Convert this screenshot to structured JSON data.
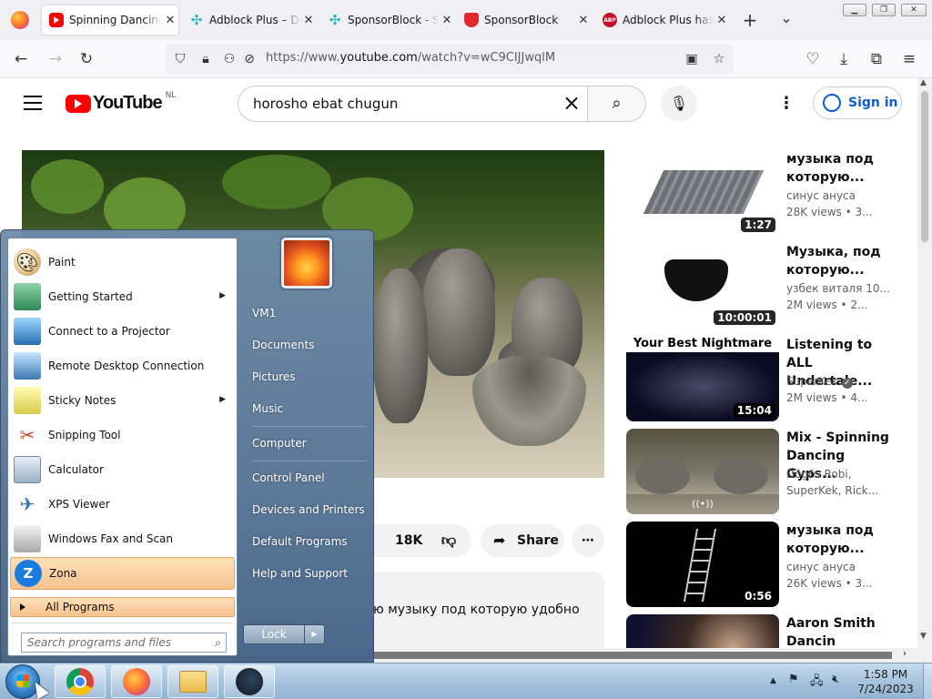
{
  "browser": {
    "tabs": [
      {
        "title": "Spinning Dancing",
        "icon": "youtube-icon",
        "active": true
      },
      {
        "title": "Adblock Plus – De",
        "icon": "sponsorblock-icon",
        "active": false
      },
      {
        "title": "SponsorBlock - Sk",
        "icon": "sponsorblock-icon",
        "active": false
      },
      {
        "title": "SponsorBlock",
        "icon": "shield-icon",
        "active": false
      },
      {
        "title": "Adblock Plus has",
        "icon": "abp-icon",
        "active": false
      }
    ],
    "close_glyph": "✕",
    "new_tab_glyph": "+",
    "tab_list_glyph": "⌄",
    "url_prefix": "https://www.",
    "url_domain": "youtube.com",
    "url_rest": "/watch?v=wC9CIJJwqlM"
  },
  "youtube": {
    "logo_word": "YouTube",
    "country_code": "NL",
    "search_query": "horosho ebat chugun",
    "sign_in": "Sign in",
    "likes": "18K",
    "share": "Share",
    "more": "⋯",
    "description_snippet": "ю музыку под которую удобно",
    "recommendations": [
      {
        "title": "музыка под которую...",
        "channel": "синус ануса",
        "views": "28K views • 3...",
        "duration": "1:27"
      },
      {
        "title": "Музыка, под которую...",
        "channel": "узбек виталя 10...",
        "views": "2M views • 2...",
        "duration": "10:00:01"
      },
      {
        "title": "Listening to ALL Undertale...",
        "channel": "SuperKek",
        "views": "2M views • 4...",
        "duration": "15:04",
        "thumb_text": "Your Best Nightmare",
        "verified": true
      },
      {
        "title": "Mix - Spinning Dancing Gyps...",
        "channel": "Dögös Robi,",
        "views": "SuperKek, Rick...",
        "duration": "",
        "thumb_badge": "((•))"
      },
      {
        "title": "музыка под которую...",
        "channel": "синус ануса",
        "views": "26K views • 3...",
        "duration": "0:56"
      },
      {
        "title": "Aaron Smith Dancin [sped...",
        "channel": "",
        "views": "",
        "duration": ""
      }
    ]
  },
  "start_menu": {
    "programs": [
      {
        "label": "Paint",
        "icon": "paint-icon",
        "submenu": false
      },
      {
        "label": "Getting Started",
        "icon": "getting-started-icon",
        "submenu": true
      },
      {
        "label": "Connect to a Projector",
        "icon": "projector-icon",
        "submenu": false
      },
      {
        "label": "Remote Desktop Connection",
        "icon": "remote-desktop-icon",
        "submenu": false
      },
      {
        "label": "Sticky Notes",
        "icon": "sticky-notes-icon",
        "submenu": true
      },
      {
        "label": "Snipping Tool",
        "icon": "scissors-icon",
        "submenu": false
      },
      {
        "label": "Calculator",
        "icon": "calculator-icon",
        "submenu": false
      },
      {
        "label": "XPS Viewer",
        "icon": "xps-icon",
        "submenu": false
      },
      {
        "label": "Windows Fax and Scan",
        "icon": "fax-icon",
        "submenu": false
      },
      {
        "label": "Zona",
        "icon": "zona-icon",
        "submenu": false
      }
    ],
    "all_programs": "All Programs",
    "search_placeholder": "Search programs and files",
    "right_items": [
      "VM1",
      "Documents",
      "Pictures",
      "Music",
      "Computer",
      "Control Panel",
      "Devices and Printers",
      "Default Programs",
      "Help and Support"
    ],
    "lock": "Lock"
  },
  "taskbar": {
    "time": "1:58 PM",
    "date": "7/24/2023"
  }
}
